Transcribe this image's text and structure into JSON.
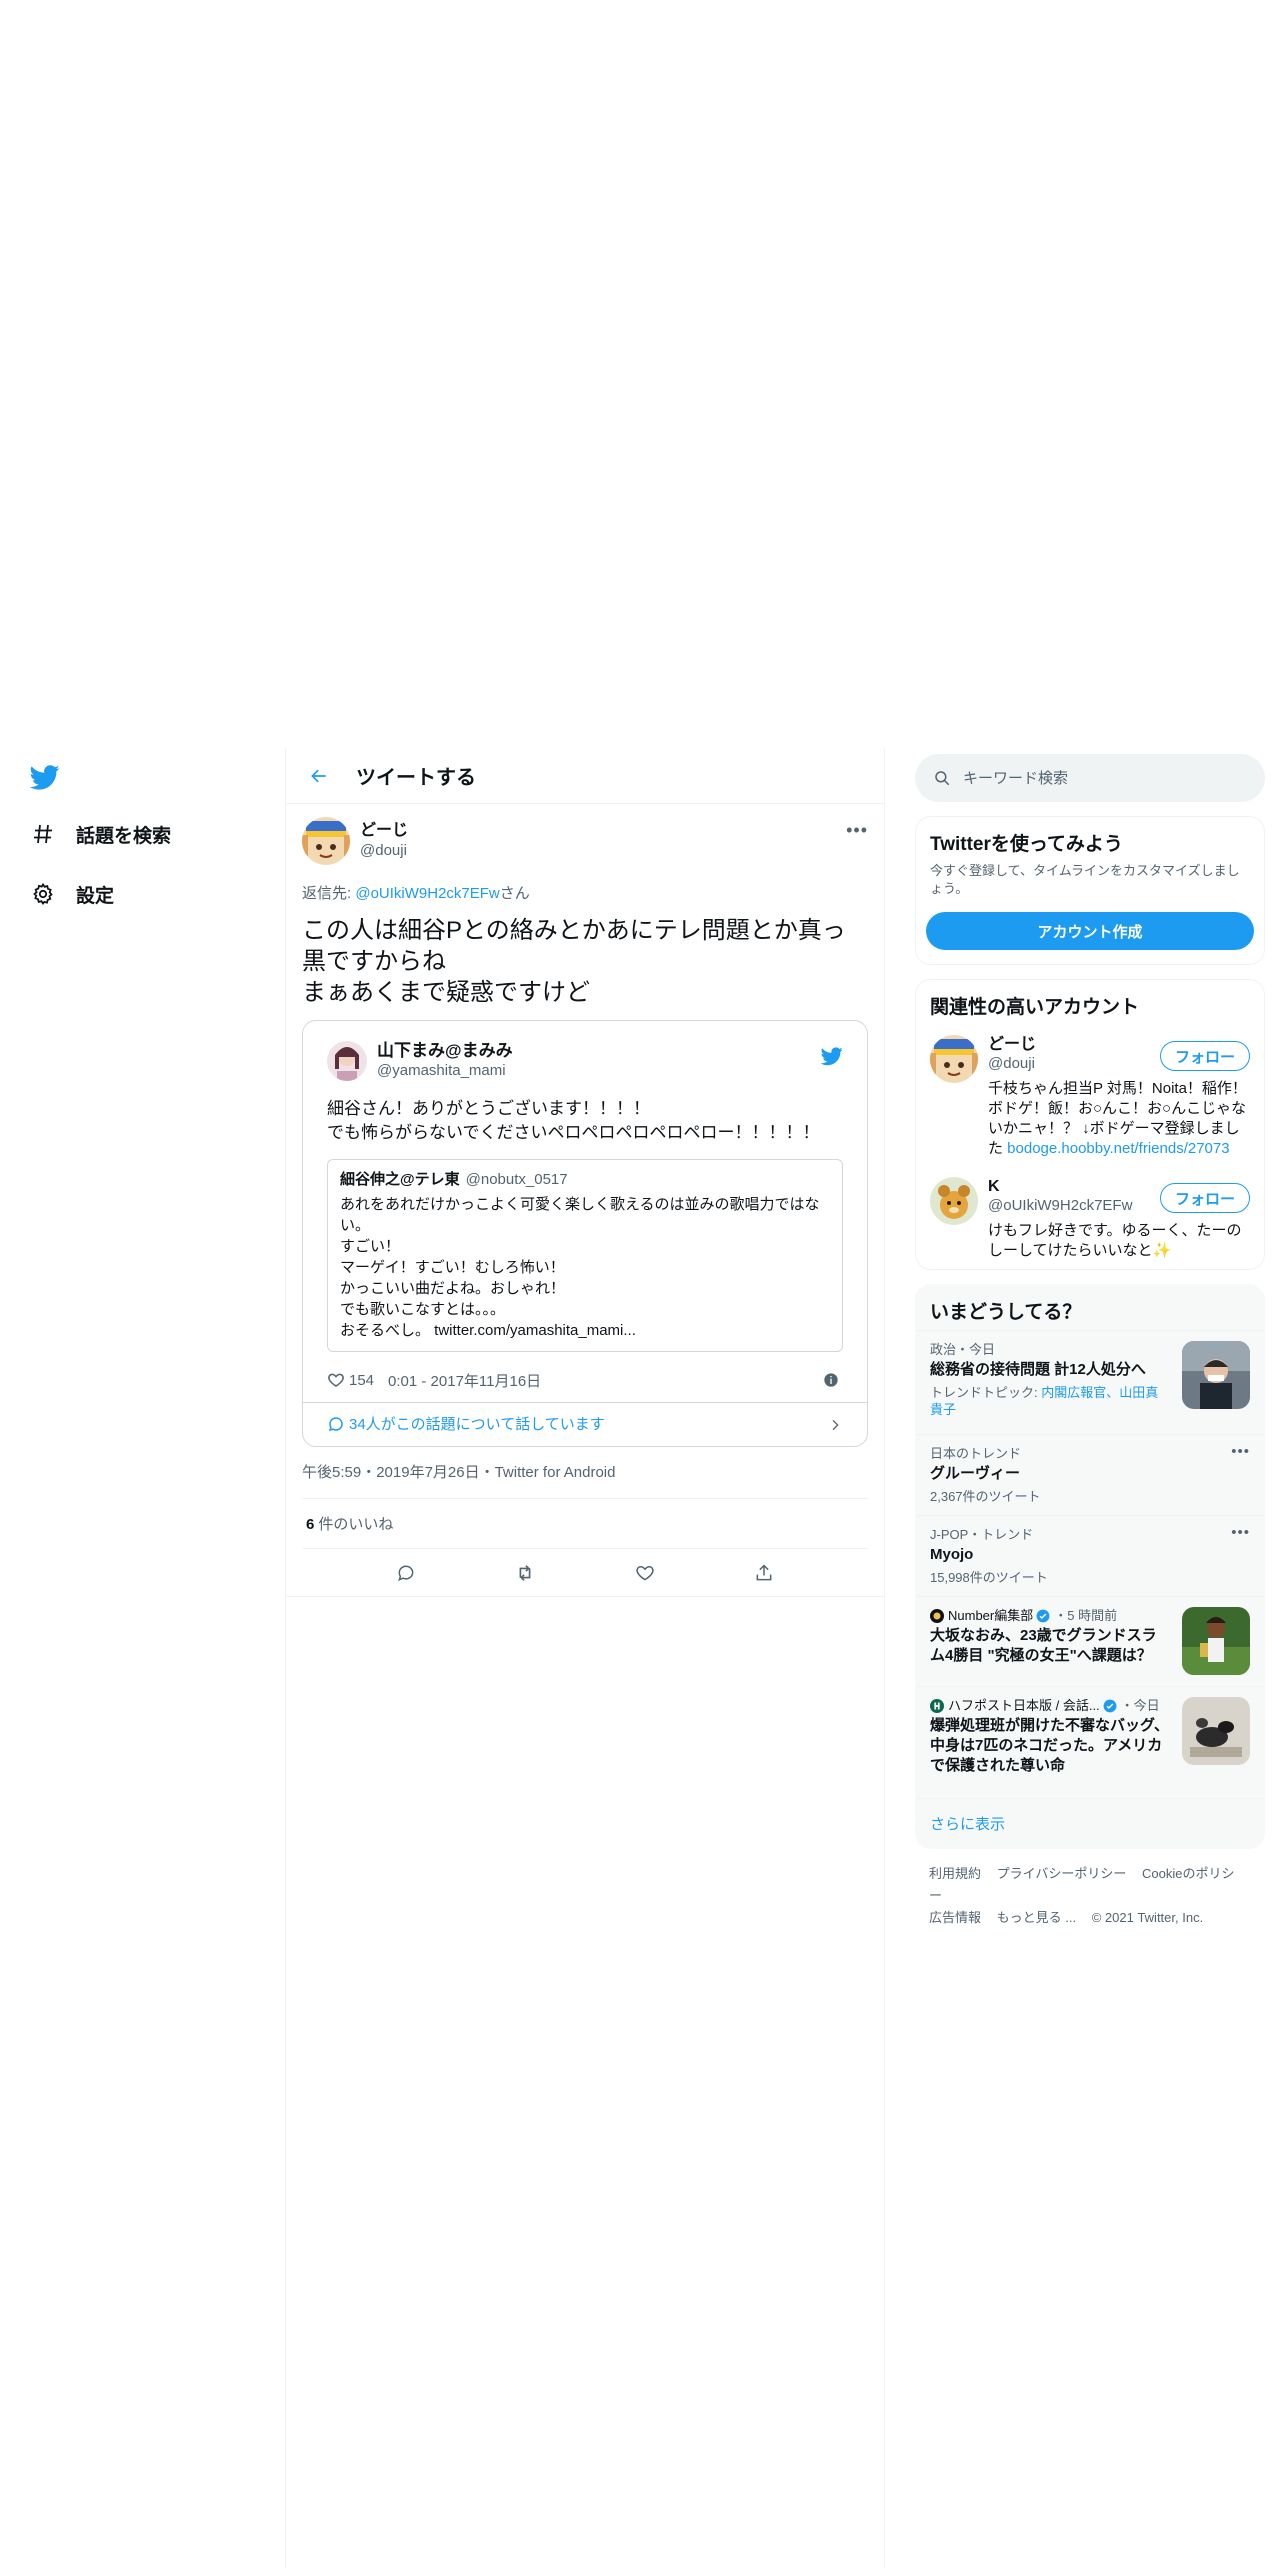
{
  "nav": {
    "items": [
      {
        "label": "話題を検索",
        "icon": "hashtag-icon"
      },
      {
        "label": "設定",
        "icon": "gear-icon"
      }
    ]
  },
  "header": {
    "title": "ツイートする"
  },
  "tweet": {
    "author_name": "どーじ",
    "author_handle": "@douji",
    "reply_prefix": "返信先: ",
    "reply_link": "@oUIkiW9H2ck7EFw",
    "reply_suffix": "さん",
    "text": "この人は細谷Pとの絡みとかあにテレ問題とか真っ黒ですからね\nまぁあくまで疑惑ですけど",
    "embed": {
      "name": "山下まみ@まみみ",
      "handle": "@yamashita_mami",
      "text": "細谷さん！ありがとうございます！！！！\nでも怖らがらないでくださいペロペロペロペロペロー！！！！！",
      "inner": {
        "name": "細谷伸之@テレ東",
        "handle": "@nobutx_0517",
        "text": "あれをあれだけかっこよく可愛く楽しく歌えるのは並みの歌唱力ではない。\nすごい！\nマーゲイ！すごい！むしろ怖い！\nかっこいい曲だよね。おしゃれ！\nでも歌いこなすとは。。。\nおそるべし。 twitter.com/yamashita_mami..."
      },
      "likes": "154",
      "time": "0:01 - 2017年11月16日",
      "conversation": "34人がこの話題について話しています"
    },
    "timestamp": "午後5:59・2019年7月26日・Twitter for Android",
    "likes_count": "6",
    "likes_label": "件のいいね"
  },
  "sidebar": {
    "search_placeholder": "キーワード検索",
    "signup": {
      "title": "Twitterを使ってみよう",
      "desc": "今すぐ登録して、タイムラインをカスタマイズしましょう。",
      "button": "アカウント作成"
    },
    "related": {
      "title": "関連性の高いアカウント",
      "follow_label": "フォロー",
      "accounts": [
        {
          "name": "どーじ",
          "handle": "@douji",
          "bio": "千枝ちゃん担当P 対馬！Noita！稲作！ボドゲ！飯！お○んこ！お○んこじゃないかニャ！？ ↓ボドゲーマ登録しました ",
          "link": "bodoge.hoobby.net/friends/27073"
        },
        {
          "name": "K",
          "handle": "@oUIkiW9H2ck7EFw",
          "bio": "けもフレ好きです。ゆるーく、たーのしーしてけたらいいなと✨",
          "link": ""
        }
      ]
    },
    "trends": {
      "title": "いまどうしてる？",
      "items": [
        {
          "meta": "政治・今日",
          "title": "総務省の接待問題 計12人処分へ",
          "sub_prefix": "トレンドトピック: ",
          "sub_link": "内閣広報官、山田真貴子"
        },
        {
          "meta": "日本のトレンド",
          "title": "グルーヴィー",
          "sub": "2,367件のツイート"
        },
        {
          "meta": "J-POP・トレンド",
          "title": "Myojo",
          "sub": "15,998件のツイート"
        },
        {
          "meta_name": "Number編集部",
          "meta_time": "・5 時間前",
          "title": "大坂なおみ、23歳でグランドスラム4勝目 \"究極の女王\"へ課題は？"
        },
        {
          "meta_name": "ハフポスト日本版 / 会話...",
          "meta_time": "・今日",
          "title": "爆弾処理班が開けた不審なバッグ、中身は7匹のネコだった。アメリカで保護された尊い命"
        }
      ],
      "show_more": "さらに表示"
    },
    "footer": {
      "links": [
        "利用規約",
        "プライバシーポリシー",
        "Cookieのポリシー",
        "広告情報",
        "もっと見る ...",
        "© 2021 Twitter, Inc."
      ]
    }
  },
  "colors": {
    "accent": "#1d9bf0",
    "text": "#0f1419",
    "muted": "#536471"
  }
}
